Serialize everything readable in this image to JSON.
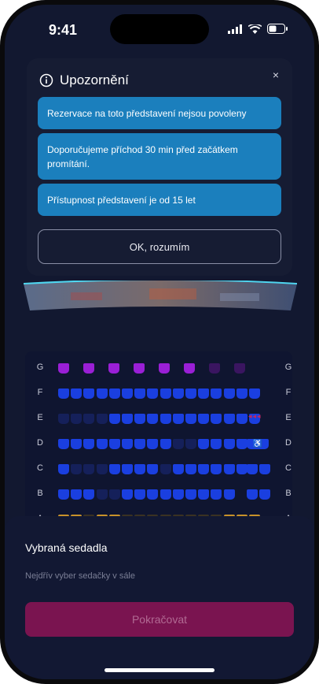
{
  "status": {
    "time": "9:41"
  },
  "alert": {
    "title": "Upozornění",
    "notices": [
      "Rezervace na toto představení nejsou povoleny",
      "Doporučujeme příchod 30 min před začátkem promítání.",
      "Přístupnost představení je od 15 let"
    ],
    "ok_label": "OK, rozumím",
    "close_icon": "×"
  },
  "seat_map": {
    "rows": [
      "G",
      "F",
      "E",
      "D",
      "C",
      "B",
      "A"
    ],
    "legend_colors": {
      "free": "#1a3fe0",
      "taken": "#15205a",
      "vip": "#9a1fd6",
      "vip_taken": "#3a1560",
      "love_seat": "#c8922a"
    }
  },
  "sheet": {
    "title": "Vybraná sedadla",
    "subtitle": "Nejdřív vyber sedačky v sále",
    "continue_label": "Pokračovat"
  },
  "icons": {
    "info": "info-icon",
    "close": "close-icon",
    "wheelchair": "wheelchair-icon"
  }
}
